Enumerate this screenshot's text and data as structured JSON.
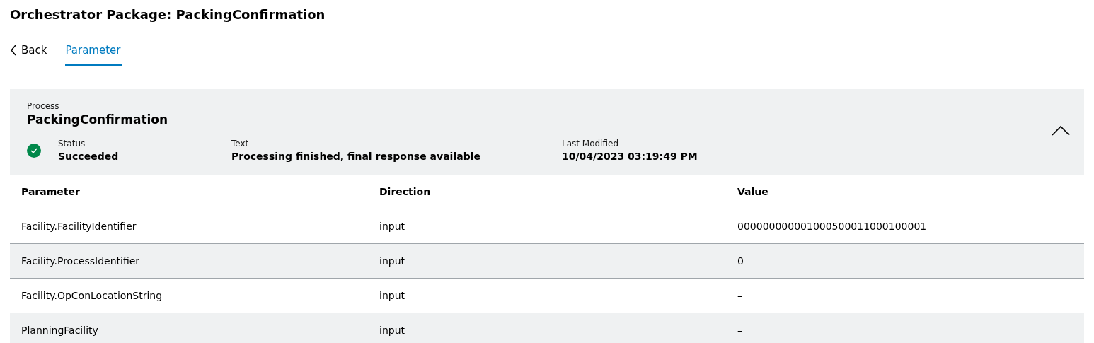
{
  "title": "Orchestrator Package: PackingConfirmation",
  "tabs": [
    {
      "kind": "back",
      "label": "Back",
      "selected": false
    },
    {
      "kind": "tab",
      "label": "Parameter",
      "selected": true
    }
  ],
  "process": {
    "label": "Process",
    "name": "PackingConfirmation",
    "expanded": true,
    "fields": [
      {
        "kind": "status",
        "label": "Status",
        "value": "Succeeded",
        "color": "#00884a"
      },
      {
        "kind": "plain",
        "label": "Text",
        "value": "Processing finished, final response available"
      },
      {
        "kind": "plain",
        "label": "Last Modified",
        "value": "10/04/2023 03:19:49 PM"
      }
    ]
  },
  "table": {
    "columns": [
      "Parameter",
      "Direction",
      "Value"
    ],
    "rows": [
      [
        "Facility.FacilityIdentifier",
        "input",
        "000000000001000500011000100001"
      ],
      [
        "Facility.ProcessIdentifier",
        "input",
        "0"
      ],
      [
        "Facility.OpConLocationString",
        "input",
        "–"
      ],
      [
        "PlanningFacility",
        "input",
        "–"
      ]
    ]
  }
}
